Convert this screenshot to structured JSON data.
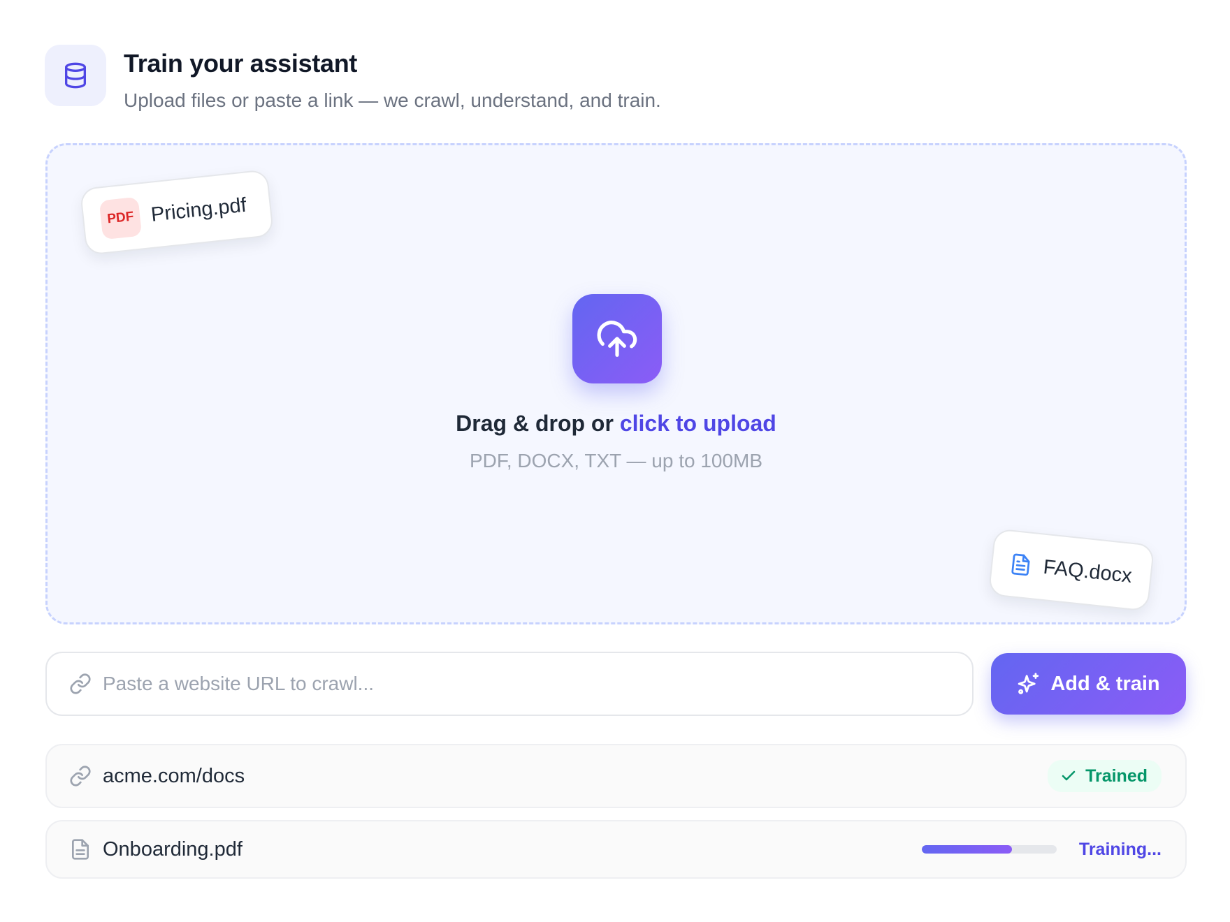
{
  "header": {
    "icon": "database-icon",
    "title": "Train your assistant",
    "subtitle": "Upload files or paste a link — we crawl, understand, and train."
  },
  "dropzone": {
    "upload_icon": "cloud-upload-icon",
    "prompt_prefix": "Drag & drop or ",
    "prompt_link": "click to upload",
    "hint": "PDF, DOCX, TXT — up to 100MB",
    "floating_files": [
      {
        "name": "Pricing.pdf",
        "badge": "PDF",
        "icon": "pdf-file-icon"
      },
      {
        "name": "FAQ.docx",
        "icon": "document-icon"
      }
    ]
  },
  "url_input": {
    "icon": "link-icon",
    "value": "",
    "placeholder": "Paste a website URL to crawl..."
  },
  "add_button": {
    "icon": "sparkles-icon",
    "label": "Add & train"
  },
  "sources": [
    {
      "name": "acme.com/docs",
      "icon": "link-icon",
      "status": "Trained",
      "status_icon": "check-icon"
    },
    {
      "name": "Onboarding.pdf",
      "icon": "file-icon",
      "status": "Training...",
      "progress": 0.67
    }
  ],
  "colors": {
    "accent": "#4f46e5",
    "accent_gradient_start": "#6366f1",
    "accent_gradient_end": "#8b5cf6",
    "success": "#059669",
    "pdf_red": "#dc2626"
  }
}
